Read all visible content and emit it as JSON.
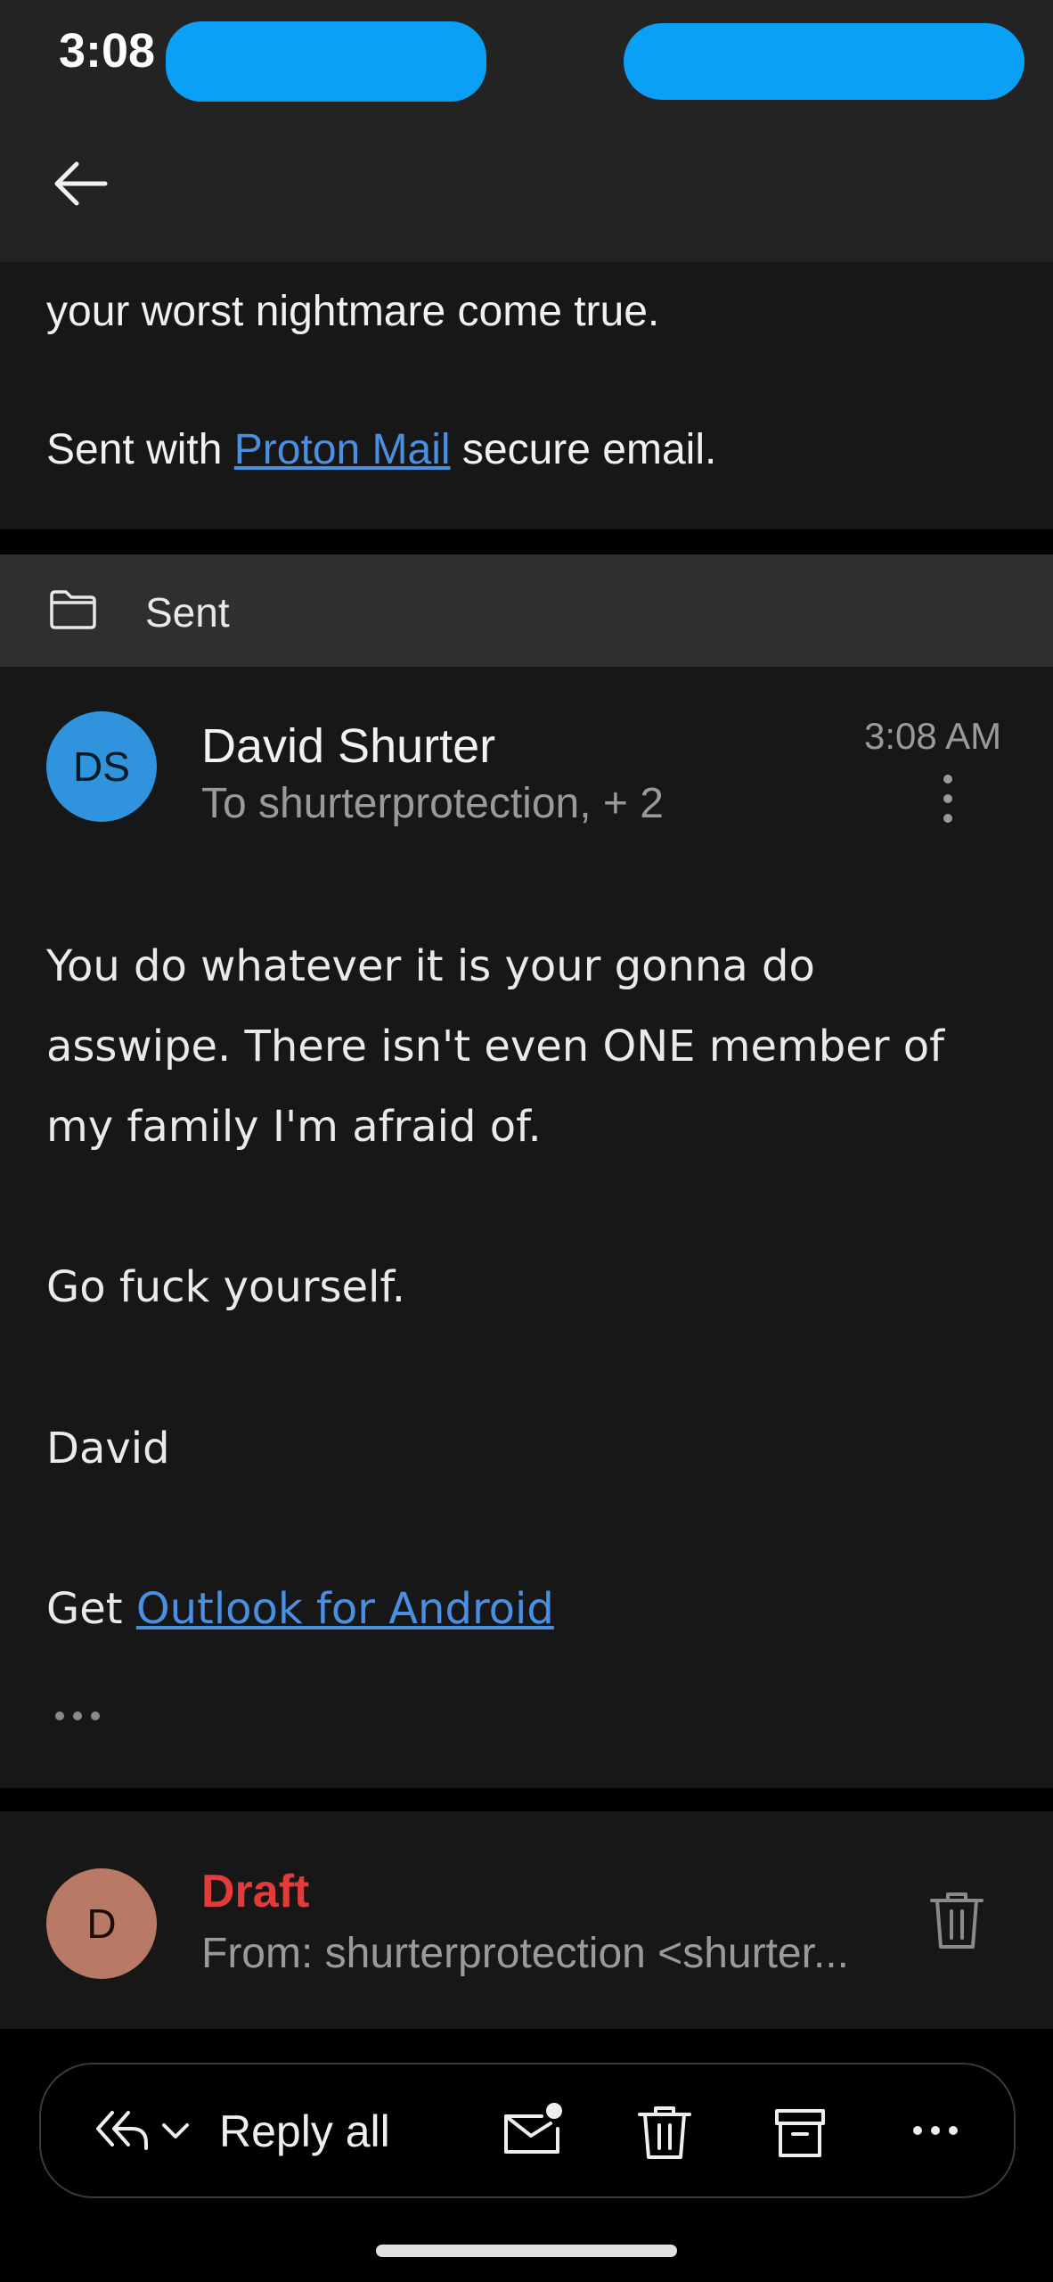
{
  "status_bar": {
    "time": "3:08"
  },
  "previous_message": {
    "line": "your worst nightmare come true.",
    "sent_prefix": "Sent with",
    "sent_link": "Proton Mail",
    "sent_suffix": "secure email."
  },
  "folder": {
    "label": "Sent"
  },
  "message": {
    "avatar_initials": "DS",
    "sender": "David Shurter",
    "recipients": "To shurterprotection, + 2",
    "time": "3:08 AM",
    "body_lines": [
      "You do whatever it is your gonna do",
      "asswipe. There isn't even ONE member of",
      "my family I'm afraid of."
    ],
    "line2": "Go fuck yourself.",
    "signature": "David",
    "footer_prefix": "Get",
    "footer_link": "Outlook for Android"
  },
  "draft": {
    "avatar_initial": "D",
    "label": "Draft",
    "from": "From: shurterprotection <shurter..."
  },
  "action_bar": {
    "reply_all_label": "Reply all"
  },
  "colors": {
    "accent_link": "#4a90e2",
    "avatar_blue": "#2f93dd",
    "avatar_draft": "#b87a66",
    "draft_red": "#e03c3c"
  }
}
